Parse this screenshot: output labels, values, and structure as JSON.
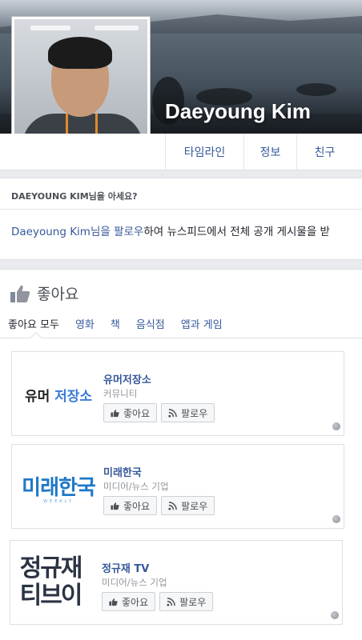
{
  "profile": {
    "name": "Daeyoung Kim"
  },
  "tabs": [
    {
      "label": "타임라인"
    },
    {
      "label": "정보"
    },
    {
      "label": "친구"
    }
  ],
  "know": {
    "title": "DAEYOUNG KIM님을 아세요?",
    "name_link": "Daeyoung Kim",
    "follow_link": "님을 팔로우",
    "rest": "하여 뉴스피드에서 전체 공개 게시물을 받"
  },
  "likes": {
    "title": "좋아요",
    "filters": [
      {
        "label": "좋아요 모두"
      },
      {
        "label": "영화"
      },
      {
        "label": "책"
      },
      {
        "label": "음식점"
      },
      {
        "label": "앱과 게임"
      }
    ],
    "pages": [
      {
        "name": "유머저장소",
        "category": "커뮤니티",
        "logo_a": "유머",
        "logo_b": "저장소",
        "like": "좋아요",
        "follow": "팔로우"
      },
      {
        "name": "미래한국",
        "category": "미디어/뉴스 기업",
        "logo_a": "미래한국",
        "logo_b": "WEEKLY",
        "like": "좋아요",
        "follow": "팔로우"
      },
      {
        "name": "정규재 TV",
        "category": "미디어/뉴스 기업",
        "logo_a": "정규재",
        "logo_b": "티브이",
        "like": "좋아요",
        "follow": "팔로우"
      }
    ]
  },
  "colors": {
    "link": "#365899",
    "background": "#e9ebee"
  }
}
